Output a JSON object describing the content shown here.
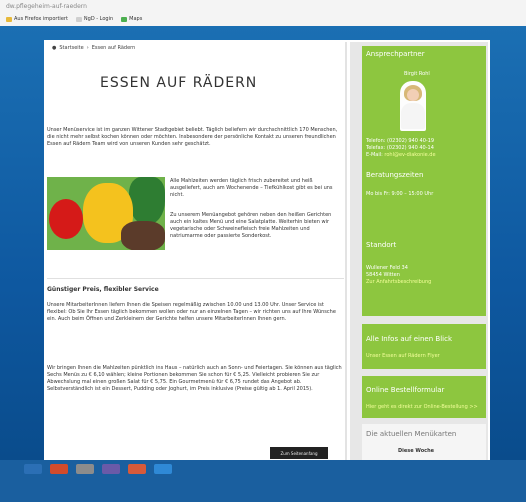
{
  "browser": {
    "url": "dw.pflegeheim-auf-raedern",
    "bookmarks": [
      "Aus Firefox importiert",
      "NgD - Login",
      "Maps"
    ]
  },
  "breadcrumb": [
    "Startseite",
    "Essen auf Rädern"
  ],
  "page": {
    "title": "ESSEN AUF RÄDERN",
    "intro": "Unser Menüservice ist im ganzen Wittener Stadtgebiet beliebt. Täglich beliefern wir durchschnittlich 170 Menschen, die nicht mehr selbst kochen können oder möchten. Insbesondere der persönliche Kontakt zu unseren freundlichen Essen auf Rädern Team wird von unseren Kunden sehr geschätzt.",
    "float_text_1": "Alle Mahlzeiten werden täglich frisch zubereitet und heiß ausgeliefert, auch am Wochenende – Tiefkühlkost gibt es bei uns nicht.",
    "float_text_2": "Zu unserem Menüangebot gehören neben den heißen Gerichten auch ein kaltes Menü und eine Salatplatte. Weiterhin bieten wir vegetarische oder Schweinefleisch freie Mahlzeiten und natriumarme oder passierte Sonderkost.",
    "subheading": "Günstiger Preis, flexibler Service",
    "service_text": "Unsere MitarbeiterInnen liefern Ihnen die Speisen regelmäßig zwischen 10.00 und 13.00 Uhr. Unser Service ist flexibel: Ob Sie Ihr Essen täglich bekommen wollen oder nur an einzelnen Tagen – wir richten uns auf Ihre Wünsche ein. Auch beim Öffnen und Zerkleinern der Gerichte helfen unsere MitarbeiterInnen Ihnen gern.",
    "price_text": "Wir bringen Ihnen die Mahlzeiten pünktlich ins Haus – natürlich auch an Sonn- und Feiertagen. Sie können aus täglich Sechs Menüs zu € 6,10 wählen; kleine Portionen bekommen Sie schon für € 5,25. Vielleicht probieren Sie zur Abwechslung mal einen großen Salat für € 5,75. Ein Gourmetmenü für € 6,75 rundet das Angebot ab. Selbstverständlich ist ein Dessert, Pudding oder Joghurt, im Preis inklusive (Preise gültig ab 1. April 2015).",
    "cookie_label": "Zum Seitenanfang"
  },
  "sidebar": {
    "contact_title": "Ansprechpartner",
    "contact_name": "Birgit Rohl",
    "phone_label": "Telefon:",
    "phone": "(02302) 940 40-19",
    "fax_label": "Telefax:",
    "fax": "(02302) 940 40-14",
    "mail_label": "E-Mail:",
    "mail": "rohl@ev-diakonie.de",
    "hours_title": "Beratungszeiten",
    "hours": "Mo bis Fr: 9:00 – 15:00 Uhr",
    "location_title": "Standort",
    "street": "Wullener Feld 34",
    "city": "58454 Witten",
    "route_link": "Zur Anfahrtsbeschreibung",
    "info_title": "Alle Infos auf einen Blick",
    "info_link": "Unser Essen auf Rädern Flyer",
    "order_title": "Online Bestellformular",
    "order_link": "Hier geht es direkt zur Online-Bestellung >>",
    "menu_title": "Die aktuellen Menükarten",
    "menu_week": "Diese Woche"
  }
}
